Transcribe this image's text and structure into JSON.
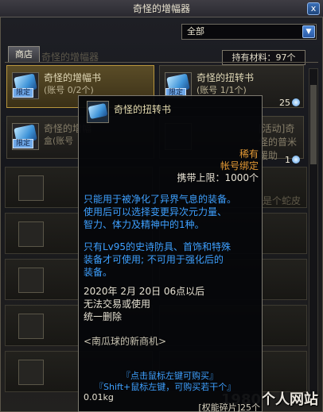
{
  "window": {
    "title": "奇怪的增幅器",
    "close_label": "x"
  },
  "filter": {
    "selected": "全部",
    "arrow": "▼"
  },
  "tabs": [
    {
      "label": "商店"
    }
  ],
  "materials": {
    "label": "持有材料：97个"
  },
  "background_title": "奇怪的增幅器",
  "items": [
    {
      "name": "奇怪的增幅书",
      "sub": "(账号 0/2个)",
      "tag": "限定"
    },
    {
      "name": "奇怪的扭转书",
      "sub": "(账号 1/1个)",
      "tag": "限定",
      "price": "25"
    },
    {
      "name": "奇怪的增幅",
      "sub": "盒(账号",
      "tag": "限定"
    },
    {
      "name": "[活动]奇怪的普米援助",
      "price": "1"
    }
  ],
  "background_right_text": "是个蛇皮",
  "watermark": "1980个人网站",
  "tooltip": {
    "name": "奇怪的扭转书",
    "rarity": "稀有",
    "binding": "帐号绑定",
    "carry_limit": "携带上限：1000个",
    "desc_lines": [
      "只能用于被净化了异界气息的装备。",
      "使用后可以选择变更异次元力量、",
      "智力、体力及精神中的1种。"
    ],
    "desc2_lines": [
      "只有Lv95的史诗防具、首饰和特殊",
      "装备才可使用; 不可用于强化后的",
      "装备。"
    ],
    "date_lines": [
      "2020年 2月 20日 06点以后",
      "无法交易或使用",
      "统一删除"
    ],
    "shop": "<南瓜球的新商机>",
    "buy_line1": "『点击鼠标左键可购买』",
    "buy_line2": "『Shift+鼠标左键，可购买若干个』",
    "weight": "0.01kg",
    "fragment": "[权能碎片]25个"
  },
  "colors": {
    "accent_blue": "#3ea0ff",
    "rare_orange": "#e49a35",
    "gold_border": "#b7953d"
  }
}
